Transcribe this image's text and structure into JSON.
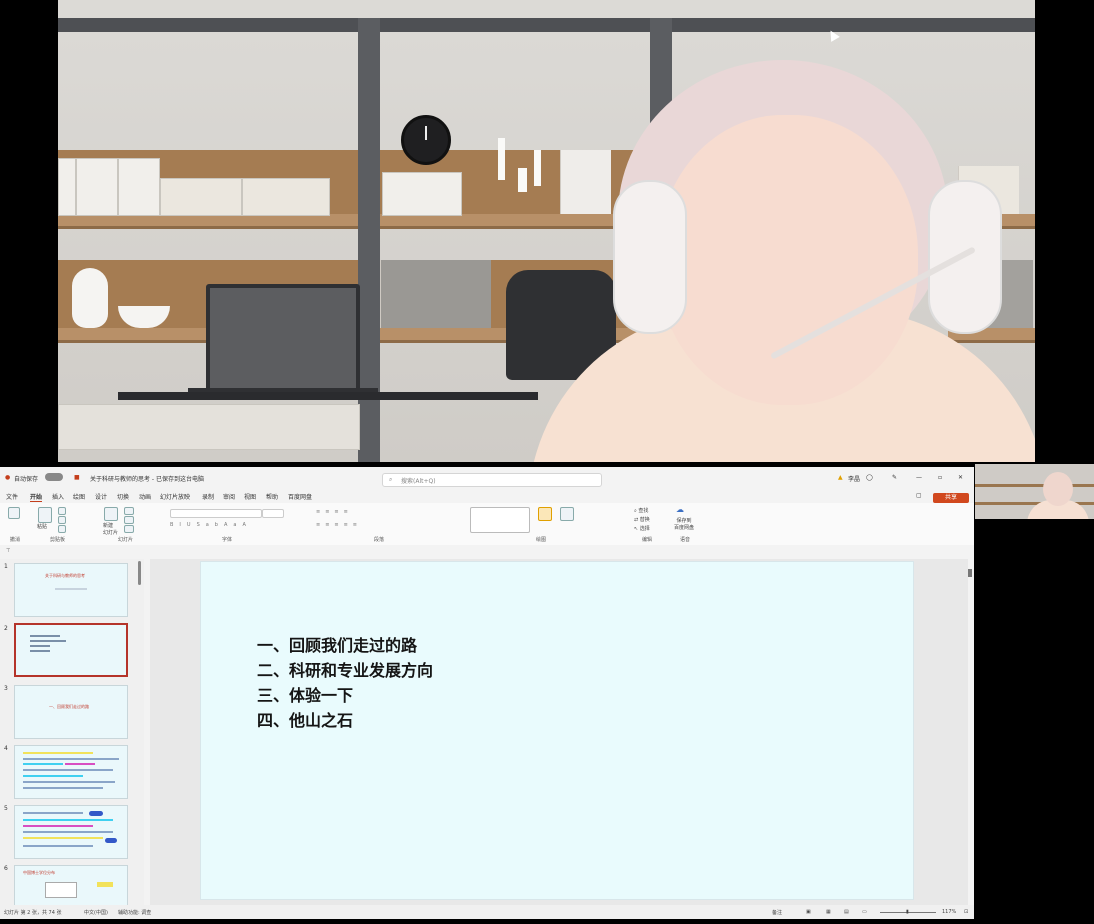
{
  "app": {
    "title": "关于科研与教师的思考 - 已保存到这台电脑",
    "autosave_label": "自动保存",
    "search_placeholder": "搜索(Alt+Q)",
    "user_name": "李晶"
  },
  "menu": [
    "文件",
    "开始",
    "插入",
    "绘图",
    "设计",
    "切换",
    "动画",
    "幻灯片放映",
    "录制",
    "审阅",
    "视图",
    "帮助",
    "百度网盘"
  ],
  "share_label": "共享",
  "ribbon_groups": [
    "撤消",
    "剪贴板",
    "幻灯片",
    "字体",
    "段落",
    "绘图",
    "编辑",
    "语音"
  ],
  "ribbon_buttons": {
    "paste": "粘贴",
    "new_slide": "新建\n幻灯片",
    "dictate": "听写",
    "find": "查找",
    "replace": "替换",
    "select": "选择",
    "baidu_save": "保存到\n百度网盘"
  },
  "slide_thumbnails": [
    {
      "number": "1",
      "title": "关于科研与教师的思考"
    },
    {
      "number": "2",
      "title": ""
    },
    {
      "number": "3",
      "title": "一、回顾我们走过的路"
    },
    {
      "number": "4",
      "title": ""
    },
    {
      "number": "5",
      "title": ""
    },
    {
      "number": "6",
      "title": "中国博士学位分布"
    }
  ],
  "slide": {
    "agenda": [
      "一、回顾我们走过的路",
      "二、科研和专业发展方向",
      "三、体验一下",
      "四、他山之石"
    ]
  },
  "status": {
    "slide_position": "幻灯片 第 2 张，共 74 张",
    "language": "中文(中国)",
    "accessibility": "辅助功能: 调查",
    "notes": "备注",
    "zoom": "117%"
  },
  "colors": {
    "slide_bg": "#e9fbfd",
    "share_button": "#d1481e",
    "selected_thumb_border": "#b5342a"
  }
}
